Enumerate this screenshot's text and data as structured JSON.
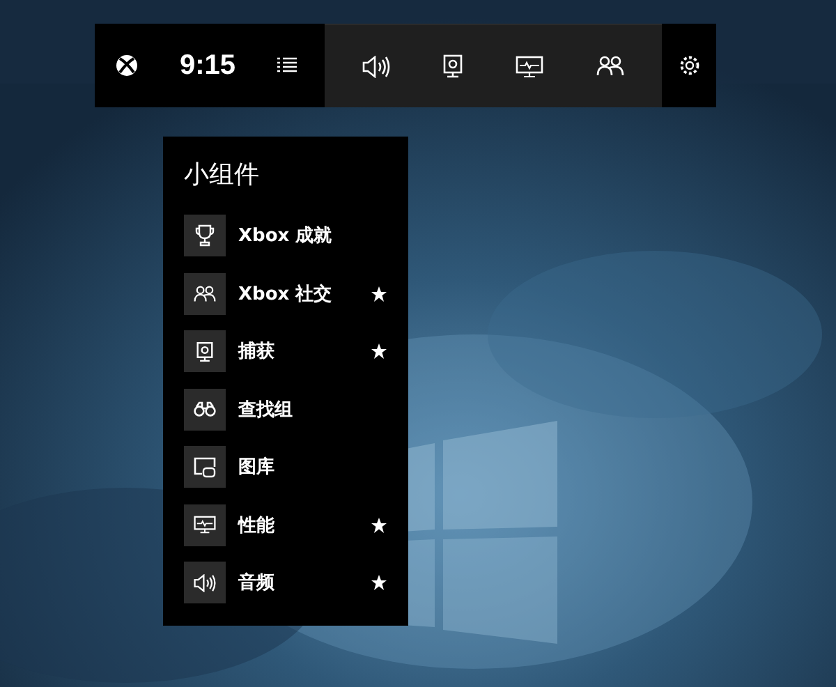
{
  "top_bar": {
    "time": "9:15"
  },
  "widget_menu": {
    "title": "小组件",
    "items": [
      {
        "kind": "achievements",
        "label": "Xbox 成就",
        "favorite": false
      },
      {
        "kind": "social",
        "label": "Xbox 社交",
        "favorite": true
      },
      {
        "kind": "capture",
        "label": "捕获",
        "favorite": true
      },
      {
        "kind": "lfg",
        "label": "查找组",
        "favorite": false
      },
      {
        "kind": "gallery",
        "label": "图库",
        "favorite": false
      },
      {
        "kind": "performance",
        "label": "性能",
        "favorite": true
      },
      {
        "kind": "audio",
        "label": "音频",
        "favorite": true
      }
    ]
  }
}
